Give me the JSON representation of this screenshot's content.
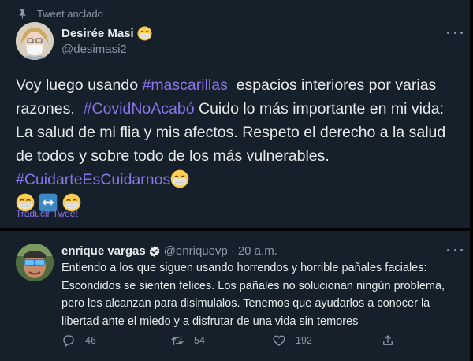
{
  "pinned_label": "Tweet anclado",
  "tweet1": {
    "author_name": "Desirée Masi",
    "author_handle": "@desimasi2",
    "text_a": "Voy luego usando ",
    "tag_1": "#mascarillas",
    "text_b": "  espacios interiores por varias razones.  ",
    "tag_2": "#CovidNoAcabó",
    "text_c": " Cuido lo más importante en mi vida: La salud de mi flia y mis afectos. Respeto el derecho a la salud de todos y sobre todo de los más vulnerables. ",
    "tag_3": "#CuidarteEsCuidarnos",
    "translate_label": "Traducir Tweet"
  },
  "tweet2": {
    "author_name": "enrique vargas",
    "author_handle": "@enriquevp",
    "separator": "·",
    "time": "20 a.m.",
    "text": "Entiendo a los que siguen usando horrendos y horrible pañales faciales: Escondidos se sienten felices. Los pañales no solucionan ningún problema, pero les alcanzan para disimulalos. Tenemos que ayudarlos a conocer la libertad ante el miedo y a disfrutar de una vida sin temores",
    "replies": "46",
    "retweets": "54",
    "likes": "192"
  },
  "colors": {
    "background": "#15202b",
    "accent_hashtag": "#8b74e8",
    "muted_text": "#8b98a5",
    "verified": "#1d9bf0"
  },
  "icons": [
    "pin-icon",
    "face-mask-emoji",
    "left-right-arrow-emoji",
    "more-icon",
    "verified-badge-icon",
    "reply-icon",
    "retweet-icon",
    "like-icon",
    "share-icon"
  ]
}
